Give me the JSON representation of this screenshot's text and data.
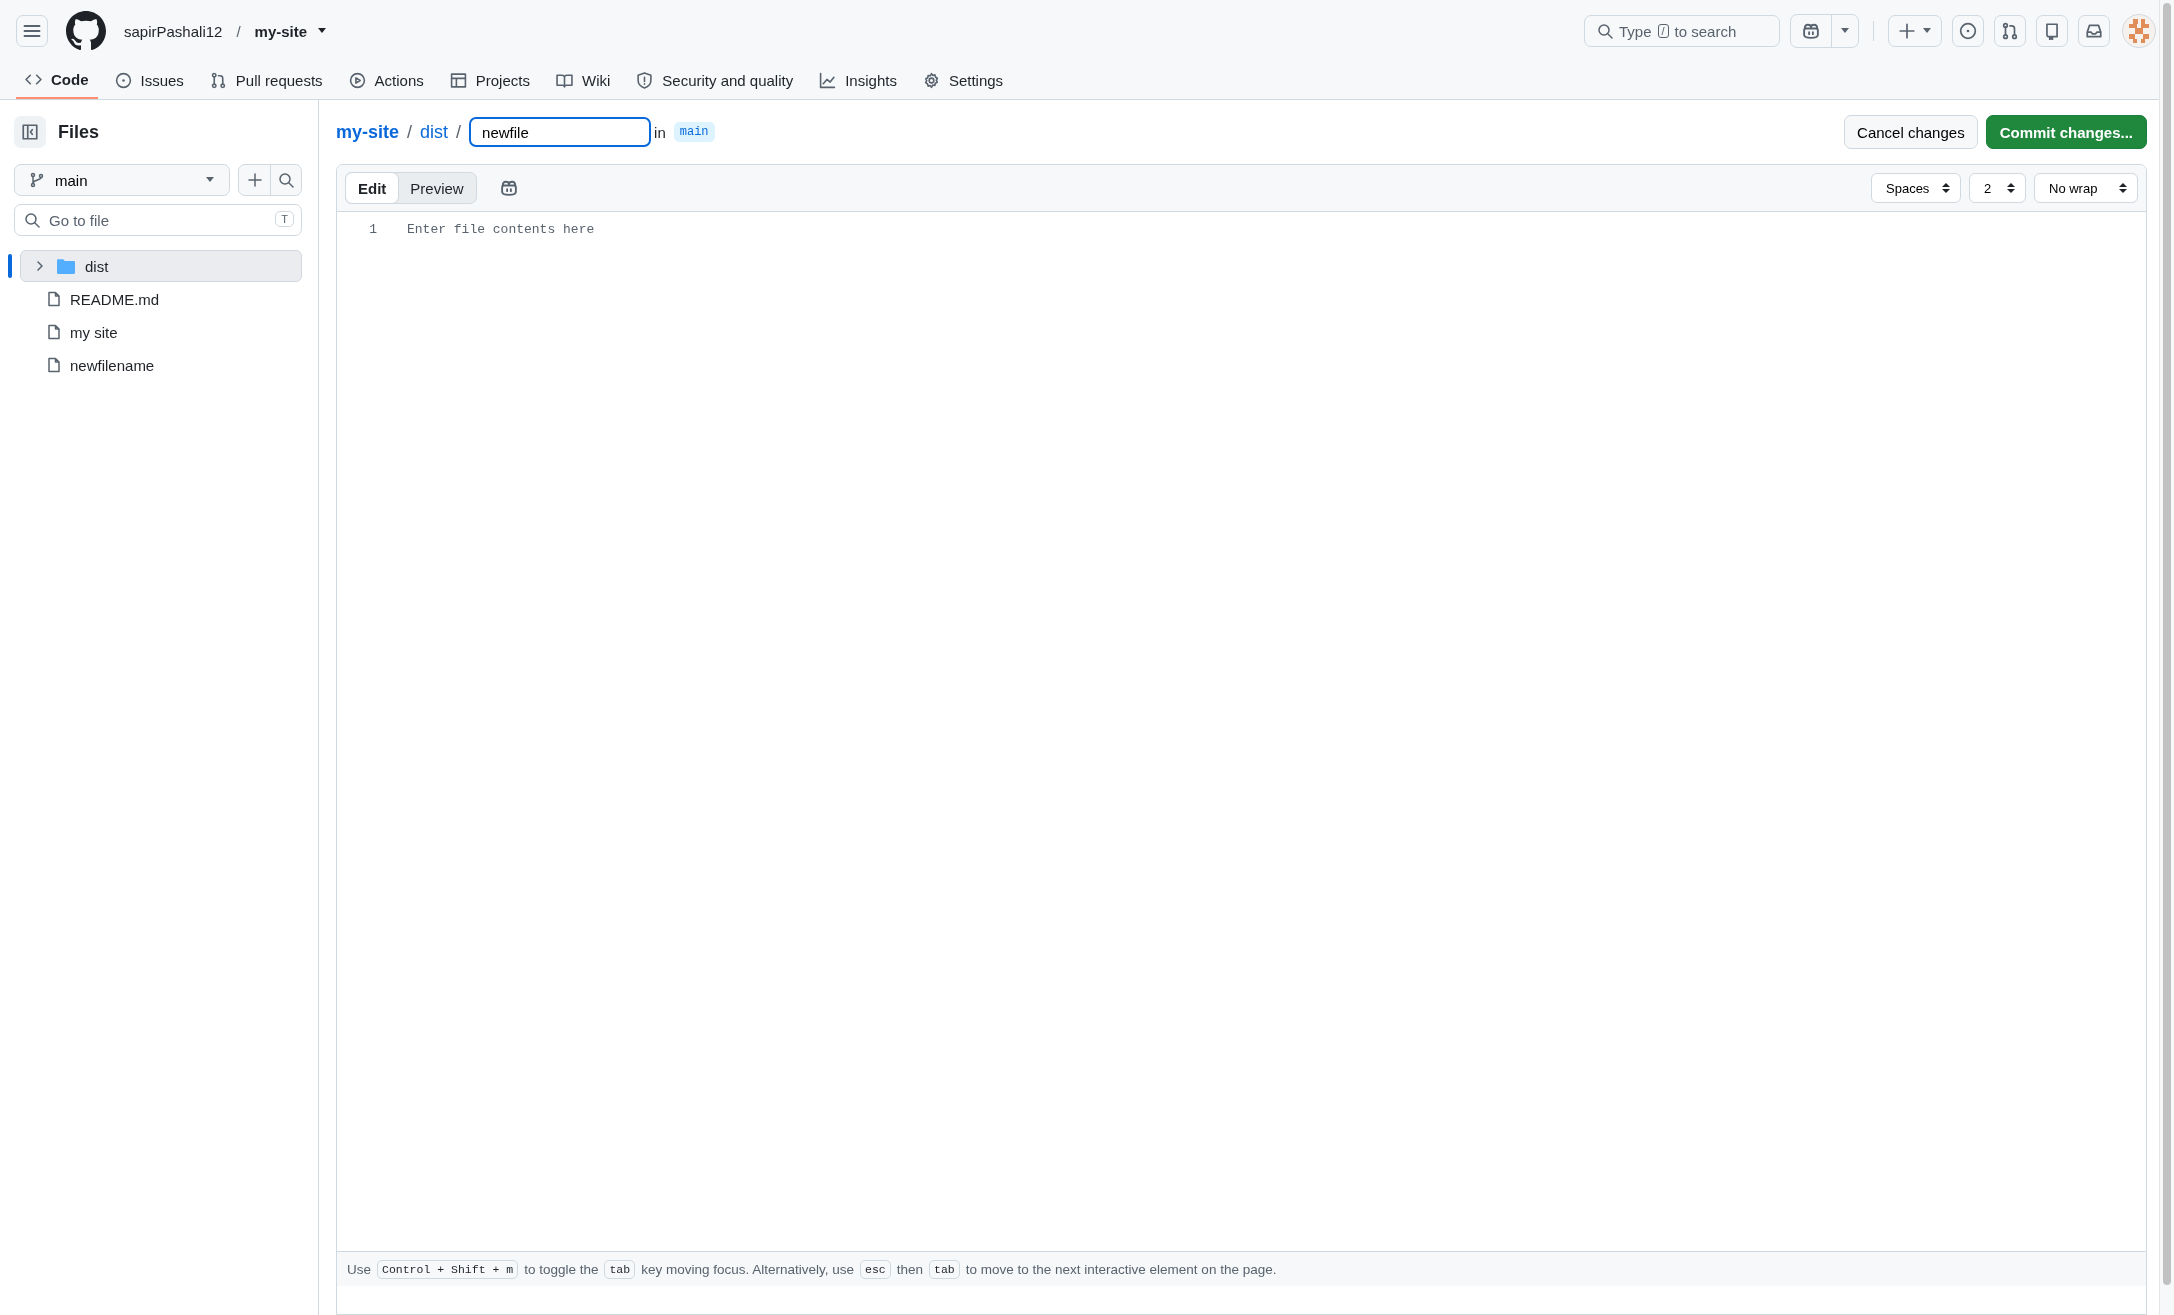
{
  "header": {
    "owner": "sapirPashali12",
    "separator": "/",
    "repo": "my-site",
    "search": {
      "placeholder_parts": [
        "Type",
        "/",
        "to search"
      ]
    }
  },
  "repo_tabs": [
    {
      "label": "Code",
      "selected": true
    },
    {
      "label": "Issues",
      "selected": false
    },
    {
      "label": "Pull requests",
      "selected": false
    },
    {
      "label": "Actions",
      "selected": false
    },
    {
      "label": "Projects",
      "selected": false
    },
    {
      "label": "Wiki",
      "selected": false
    },
    {
      "label": "Security and quality",
      "selected": false
    },
    {
      "label": "Insights",
      "selected": false
    },
    {
      "label": "Settings",
      "selected": false
    }
  ],
  "sidebar": {
    "title": "Files",
    "branch": "main",
    "filter": {
      "placeholder": "Go to file",
      "shortcut": "T"
    },
    "tree": [
      {
        "name": "dist",
        "kind": "folder",
        "expanded": false,
        "selected": true
      },
      {
        "name": "README.md",
        "kind": "file",
        "selected": false
      },
      {
        "name": "my site",
        "kind": "file",
        "selected": false
      },
      {
        "name": "newfilename",
        "kind": "file",
        "selected": false
      }
    ]
  },
  "editor": {
    "breadcrumb": [
      {
        "kind": "link",
        "text": "my-site"
      },
      {
        "kind": "separator",
        "text": "/"
      },
      {
        "kind": "link",
        "text": "dist"
      },
      {
        "kind": "separator",
        "text": "/"
      }
    ],
    "filename": "newfile",
    "in_label": "in",
    "branch": "main",
    "buttons": {
      "cancel": "Cancel changes",
      "commit": "Commit changes..."
    },
    "modes": [
      {
        "label": "Edit",
        "selected": true
      },
      {
        "label": "Preview",
        "selected": false
      }
    ],
    "selects": [
      "Spaces",
      "2",
      "No wrap"
    ],
    "line_numbers": [
      "1"
    ],
    "placeholder": "Enter file contents here",
    "hint": [
      {
        "kind": "text",
        "text": "Use"
      },
      {
        "kind": "key",
        "text": "Control + Shift + m"
      },
      {
        "kind": "text",
        "text": "to toggle the"
      },
      {
        "kind": "key",
        "text": "tab"
      },
      {
        "kind": "text",
        "text": "key moving focus. Alternatively, use"
      },
      {
        "kind": "key",
        "text": "esc"
      },
      {
        "kind": "text",
        "text": "then"
      },
      {
        "kind": "key",
        "text": "tab"
      },
      {
        "kind": "text",
        "text": "to move to the next interactive element on the page."
      }
    ]
  }
}
